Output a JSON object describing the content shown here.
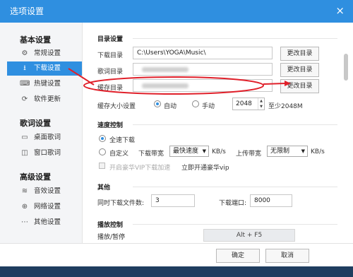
{
  "window": {
    "title": "选项设置",
    "close_icon": "×"
  },
  "sidebar": {
    "sections": [
      {
        "title": "基本设置",
        "items": [
          {
            "label": "常规设置",
            "icon": "⚙",
            "active": false
          },
          {
            "label": "下载设置",
            "icon": "⭳",
            "active": true
          },
          {
            "label": "热键设置",
            "icon": "⌨",
            "active": false
          },
          {
            "label": "软件更新",
            "icon": "⟳",
            "active": false
          }
        ]
      },
      {
        "title": "歌词设置",
        "items": [
          {
            "label": "桌面歌词",
            "icon": "▭",
            "active": false
          },
          {
            "label": "窗口歌词",
            "icon": "◫",
            "active": false
          }
        ]
      },
      {
        "title": "高级设置",
        "items": [
          {
            "label": "音效设置",
            "icon": "≋",
            "active": false
          },
          {
            "label": "网络设置",
            "icon": "⊕",
            "active": false
          },
          {
            "label": "其他设置",
            "icon": "⋯",
            "active": false
          }
        ]
      }
    ]
  },
  "dirs": {
    "group": "目录设置",
    "download_label": "下载目录",
    "download_value": "C:\\Users\\YOGA\\Music\\",
    "lyrics_label": "歌词目录",
    "cache_label": "缓存目录",
    "change_btn": "更改目录",
    "cache_size_label": "缓存大小设置",
    "auto_label": "自动",
    "manual_label": "手动",
    "size_value": "2048",
    "size_hint": "至少2048M"
  },
  "speed": {
    "group": "速度控制",
    "full_label": "全速下载",
    "custom_label": "自定义",
    "down_bw_label": "下载带宽",
    "down_bw_value": "最快速度",
    "kbs": "KB/s",
    "up_bw_label": "上传带宽",
    "up_bw_value": "无限制",
    "vip_label": "开启豪华VIP下载加速",
    "vip_link": "立即开通豪华vip"
  },
  "other": {
    "group": "其他",
    "concurrent_label": "同时下载文件数:",
    "concurrent_value": "3",
    "port_label": "下载端口:",
    "port_value": "8000"
  },
  "playback": {
    "group": "播放控制",
    "play_pause_label": "播放/暂停",
    "play_pause_key": "Alt + F5"
  },
  "footer": {
    "ok": "确定",
    "cancel": "取消"
  },
  "annotation_color": "#e0202a"
}
